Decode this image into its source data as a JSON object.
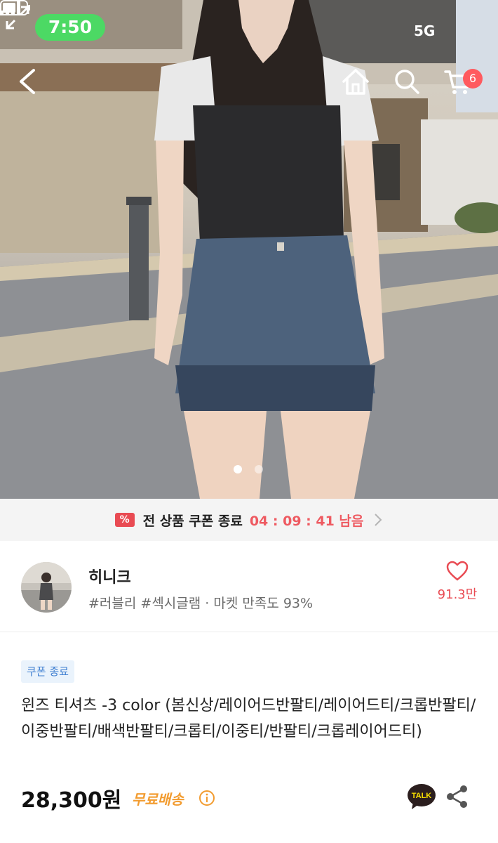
{
  "status_bar": {
    "time": "7:50",
    "network": "5G",
    "colors": {
      "time_pill": "#4cd964"
    }
  },
  "nav": {
    "icons": [
      "back-icon",
      "home-icon",
      "search-icon",
      "cart-icon"
    ],
    "cart_count": "6",
    "badge_color": "#ff5a5f"
  },
  "gallery": {
    "current_image": 1,
    "total_images": 2,
    "expand_icon": "expand-icon"
  },
  "coupon_banner": {
    "icon": "coupon-percent-icon",
    "icon_text": "%",
    "text": "전 상품 쿠폰 종료",
    "timer": "04 : 09 : 41 남음",
    "accent_color": "#e94b53"
  },
  "shop": {
    "name": "히니크",
    "tags": "#러블리 #섹시글램 · 마켓 만족도 93%",
    "like_count": "91.3만"
  },
  "product": {
    "badge": "쿠폰 종료",
    "title": "윈즈 티셔츠 -3 color (봄신상/레이어드반팔티/레이어드티/크롭반팔티/이중반팔티/배색반팔티/크롭티/이중티/반팔티/크롭레이어드티)",
    "price": "28,300원",
    "shipping": "무료배송",
    "talk_label": "TALK",
    "shipping_color": "#f29b2e"
  }
}
